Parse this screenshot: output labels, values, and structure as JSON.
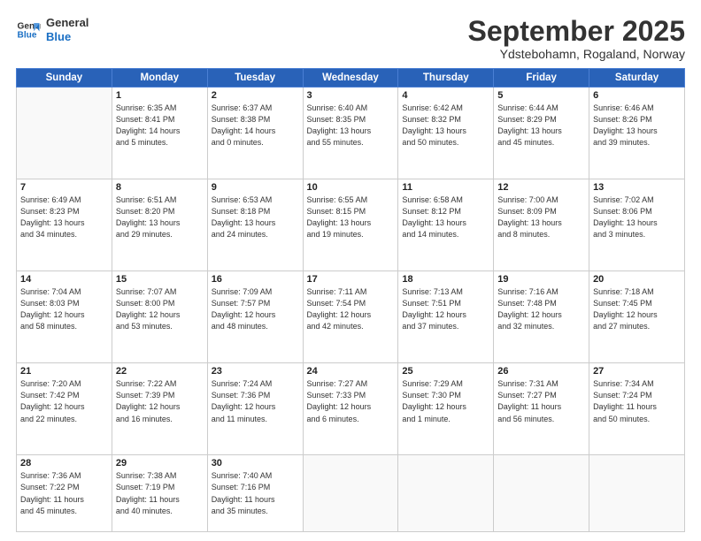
{
  "logo": {
    "line1": "General",
    "line2": "Blue"
  },
  "title": "September 2025",
  "subtitle": "Ydstebohamn, Rogaland, Norway",
  "weekdays": [
    "Sunday",
    "Monday",
    "Tuesday",
    "Wednesday",
    "Thursday",
    "Friday",
    "Saturday"
  ],
  "weeks": [
    [
      {
        "day": "",
        "info": ""
      },
      {
        "day": "1",
        "info": "Sunrise: 6:35 AM\nSunset: 8:41 PM\nDaylight: 14 hours\nand 5 minutes."
      },
      {
        "day": "2",
        "info": "Sunrise: 6:37 AM\nSunset: 8:38 PM\nDaylight: 14 hours\nand 0 minutes."
      },
      {
        "day": "3",
        "info": "Sunrise: 6:40 AM\nSunset: 8:35 PM\nDaylight: 13 hours\nand 55 minutes."
      },
      {
        "day": "4",
        "info": "Sunrise: 6:42 AM\nSunset: 8:32 PM\nDaylight: 13 hours\nand 50 minutes."
      },
      {
        "day": "5",
        "info": "Sunrise: 6:44 AM\nSunset: 8:29 PM\nDaylight: 13 hours\nand 45 minutes."
      },
      {
        "day": "6",
        "info": "Sunrise: 6:46 AM\nSunset: 8:26 PM\nDaylight: 13 hours\nand 39 minutes."
      }
    ],
    [
      {
        "day": "7",
        "info": "Sunrise: 6:49 AM\nSunset: 8:23 PM\nDaylight: 13 hours\nand 34 minutes."
      },
      {
        "day": "8",
        "info": "Sunrise: 6:51 AM\nSunset: 8:20 PM\nDaylight: 13 hours\nand 29 minutes."
      },
      {
        "day": "9",
        "info": "Sunrise: 6:53 AM\nSunset: 8:18 PM\nDaylight: 13 hours\nand 24 minutes."
      },
      {
        "day": "10",
        "info": "Sunrise: 6:55 AM\nSunset: 8:15 PM\nDaylight: 13 hours\nand 19 minutes."
      },
      {
        "day": "11",
        "info": "Sunrise: 6:58 AM\nSunset: 8:12 PM\nDaylight: 13 hours\nand 14 minutes."
      },
      {
        "day": "12",
        "info": "Sunrise: 7:00 AM\nSunset: 8:09 PM\nDaylight: 13 hours\nand 8 minutes."
      },
      {
        "day": "13",
        "info": "Sunrise: 7:02 AM\nSunset: 8:06 PM\nDaylight: 13 hours\nand 3 minutes."
      }
    ],
    [
      {
        "day": "14",
        "info": "Sunrise: 7:04 AM\nSunset: 8:03 PM\nDaylight: 12 hours\nand 58 minutes."
      },
      {
        "day": "15",
        "info": "Sunrise: 7:07 AM\nSunset: 8:00 PM\nDaylight: 12 hours\nand 53 minutes."
      },
      {
        "day": "16",
        "info": "Sunrise: 7:09 AM\nSunset: 7:57 PM\nDaylight: 12 hours\nand 48 minutes."
      },
      {
        "day": "17",
        "info": "Sunrise: 7:11 AM\nSunset: 7:54 PM\nDaylight: 12 hours\nand 42 minutes."
      },
      {
        "day": "18",
        "info": "Sunrise: 7:13 AM\nSunset: 7:51 PM\nDaylight: 12 hours\nand 37 minutes."
      },
      {
        "day": "19",
        "info": "Sunrise: 7:16 AM\nSunset: 7:48 PM\nDaylight: 12 hours\nand 32 minutes."
      },
      {
        "day": "20",
        "info": "Sunrise: 7:18 AM\nSunset: 7:45 PM\nDaylight: 12 hours\nand 27 minutes."
      }
    ],
    [
      {
        "day": "21",
        "info": "Sunrise: 7:20 AM\nSunset: 7:42 PM\nDaylight: 12 hours\nand 22 minutes."
      },
      {
        "day": "22",
        "info": "Sunrise: 7:22 AM\nSunset: 7:39 PM\nDaylight: 12 hours\nand 16 minutes."
      },
      {
        "day": "23",
        "info": "Sunrise: 7:24 AM\nSunset: 7:36 PM\nDaylight: 12 hours\nand 11 minutes."
      },
      {
        "day": "24",
        "info": "Sunrise: 7:27 AM\nSunset: 7:33 PM\nDaylight: 12 hours\nand 6 minutes."
      },
      {
        "day": "25",
        "info": "Sunrise: 7:29 AM\nSunset: 7:30 PM\nDaylight: 12 hours\nand 1 minute."
      },
      {
        "day": "26",
        "info": "Sunrise: 7:31 AM\nSunset: 7:27 PM\nDaylight: 11 hours\nand 56 minutes."
      },
      {
        "day": "27",
        "info": "Sunrise: 7:34 AM\nSunset: 7:24 PM\nDaylight: 11 hours\nand 50 minutes."
      }
    ],
    [
      {
        "day": "28",
        "info": "Sunrise: 7:36 AM\nSunset: 7:22 PM\nDaylight: 11 hours\nand 45 minutes."
      },
      {
        "day": "29",
        "info": "Sunrise: 7:38 AM\nSunset: 7:19 PM\nDaylight: 11 hours\nand 40 minutes."
      },
      {
        "day": "30",
        "info": "Sunrise: 7:40 AM\nSunset: 7:16 PM\nDaylight: 11 hours\nand 35 minutes."
      },
      {
        "day": "",
        "info": ""
      },
      {
        "day": "",
        "info": ""
      },
      {
        "day": "",
        "info": ""
      },
      {
        "day": "",
        "info": ""
      }
    ]
  ]
}
